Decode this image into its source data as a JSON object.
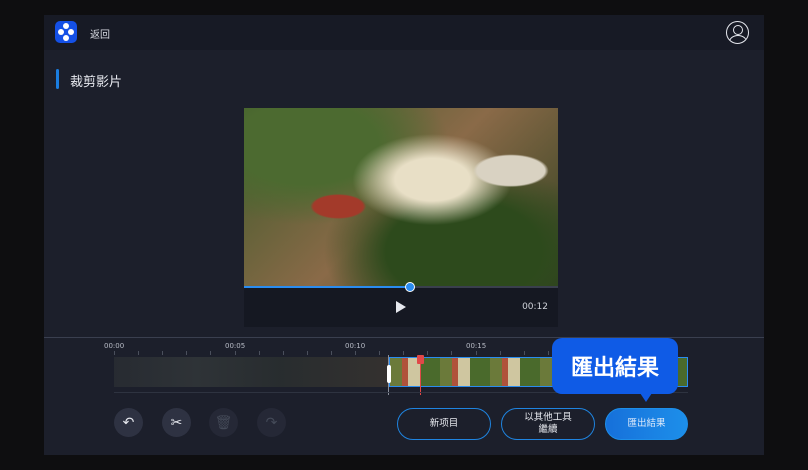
{
  "header": {
    "back_label": "返回"
  },
  "page": {
    "title": "裁剪影片"
  },
  "player": {
    "current_time": "00:12",
    "progress_percent": 53
  },
  "timeline": {
    "ticks": [
      "00:00",
      "00:05",
      "00:10",
      "00:15"
    ],
    "selection_start": "00:11.5",
    "playhead": "00:12.5"
  },
  "actions": {
    "new_project": "新项目",
    "continue_line1": "以其他工具",
    "continue_line2": "繼續",
    "export": "匯出結果"
  },
  "tooltip": {
    "text": "匯出結果"
  },
  "colors": {
    "accent": "#1f84e0",
    "tooltip": "#0f5be6",
    "playhead": "#e04848"
  }
}
